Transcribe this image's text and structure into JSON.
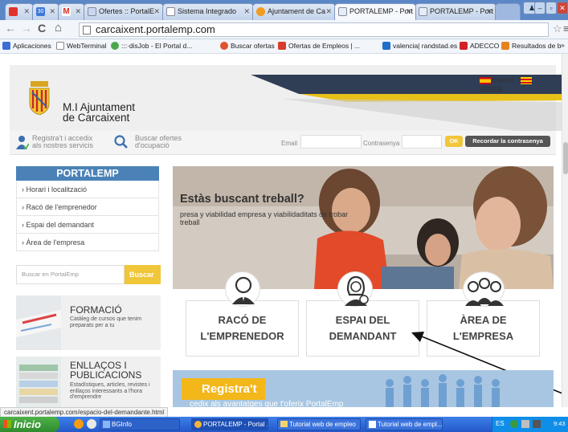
{
  "tabs": [
    {
      "label": "",
      "icon": "red-app-icon"
    },
    {
      "label": "",
      "icon": "calendar-icon"
    },
    {
      "label": "",
      "icon": "gmail-icon"
    },
    {
      "label": "Ofertes :: PortalE",
      "icon": "page-icon"
    },
    {
      "label": "Sistema Integrado",
      "icon": "document-icon"
    },
    {
      "label": "Ajuntament de Ca",
      "icon": "orange-globe-icon"
    },
    {
      "label": "PORTALEMP - Port",
      "icon": "page-icon",
      "active": true
    },
    {
      "label": "PORTALEMP - Port",
      "icon": "page-icon"
    }
  ],
  "address": {
    "url": "carcaixent.portalemp.com"
  },
  "bookmarks": [
    {
      "label": "Aplicaciones",
      "color": "#3b6fd6"
    },
    {
      "label": "WebTerminal",
      "color": "#888888"
    },
    {
      "label": ":::·disJob - El Portal d...",
      "color": "#4aa84a"
    },
    {
      "label": "Buscar ofertas",
      "color": "#e0542b"
    },
    {
      "label": "Ofertas de Empleos | ...",
      "color": "#d63d2e"
    },
    {
      "label": "valencia| randstad.es",
      "color": "#1f6fc9"
    },
    {
      "label": "ADECCO",
      "color": "#d32222"
    },
    {
      "label": "Resultados de búsque...",
      "color": "#e8821e"
    }
  ],
  "bookmarks_more": "»",
  "org": {
    "line1": "M.I Ajuntament",
    "line2": "de Carcaixent"
  },
  "langs": {
    "es": "Español",
    "va": "Valencià"
  },
  "loginbar": {
    "register_line1": "Registra't i accedix",
    "register_line2": "als nostres servicis",
    "search_line1": "Buscar ofertes",
    "search_line2": "d'ocupació",
    "email_label": "Email",
    "password_label": "Contrasenya",
    "ok": "OK",
    "remember": "Recordar la contrasenya"
  },
  "sidebar": {
    "title": "PORTALEMP",
    "items": [
      "› Horari i localització",
      "› Racó de l'emprenedor",
      "› Espai del demandant",
      "› Àrea de l'empresa"
    ],
    "search_placeholder": "Buscar en PortalEmp",
    "search_button": "Buscar"
  },
  "promos": [
    {
      "title": "FORMACIÓ",
      "desc": "Catàleg de cursos que tenim preparats per a tu"
    },
    {
      "title_line1": "ENLLAÇOS I",
      "title_line2": "PUBLICACIONS",
      "desc": "Estadístiques, articles, revistes i enllaços interessants a l'hora d'emprendre"
    }
  ],
  "hero": {
    "title": "Estàs buscant treball?",
    "subtitle": "presa y viabilidad empresa y viabilidaditats de trobar treball"
  },
  "cards": [
    {
      "line1": "RACÓ DE",
      "line2": "L'EMPRENEDOR"
    },
    {
      "line1": "ESPAI DEL",
      "line2": "DEMANDANT"
    },
    {
      "line1": "ÀREA DE",
      "line2": "L'EMPRESA"
    }
  ],
  "register_banner": {
    "button": "Registra't",
    "text": "cedix als avantatges que t'oferix PortalEmp"
  },
  "status_url": "carcaixent.portalemp.com/espacio-del-demandante.html",
  "taskbar": {
    "start": "Inicio",
    "tasks": [
      "BGInfo",
      "PORTALEMP - Portal ...",
      "Tutorial web de empleo",
      "Tutorial web de empl..."
    ],
    "lang": "ES",
    "clock": "9:43"
  }
}
